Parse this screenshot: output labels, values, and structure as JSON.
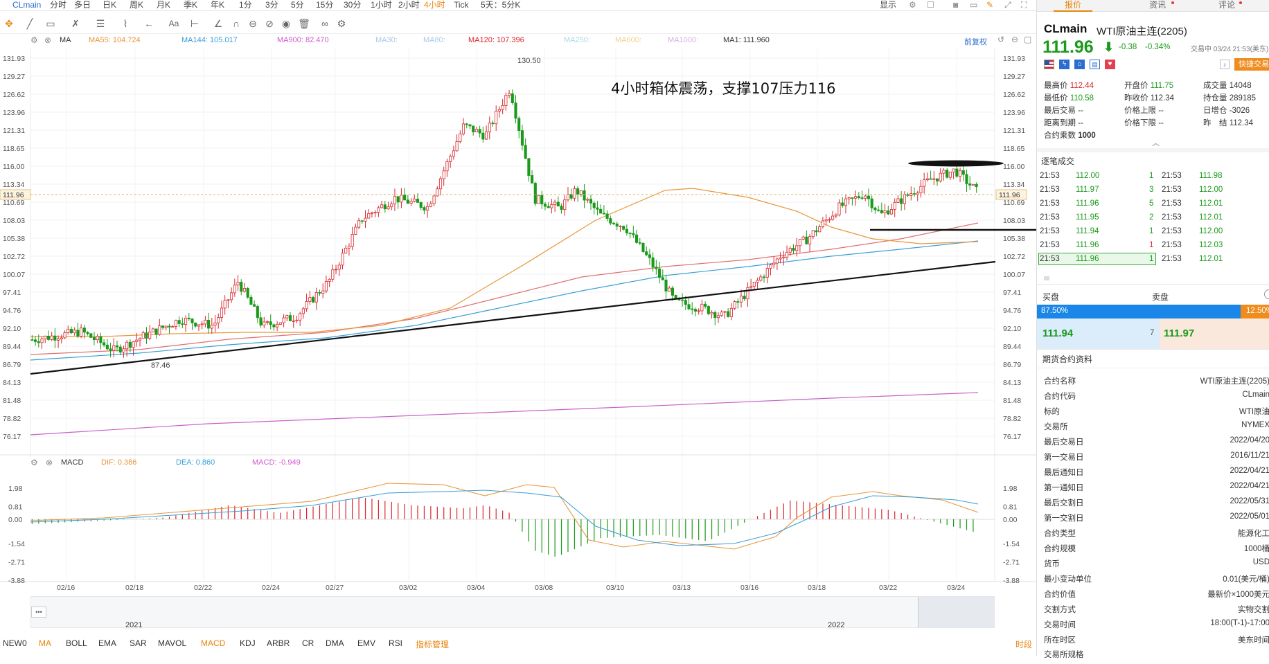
{
  "topbar": {
    "symbol": "CLmain",
    "periods": [
      "分时",
      "多日",
      "日K",
      "周K",
      "月K",
      "季K",
      "年K",
      "1分",
      "3分",
      "5分",
      "15分",
      "30分",
      "1小时",
      "2小时",
      "4小时",
      "Tick",
      "5天：5分K"
    ],
    "active_period": "4小时",
    "display": "显示"
  },
  "toolbar2": {
    "aa": "Aa"
  },
  "ma_bar": {
    "indicator": "MA",
    "items": [
      {
        "label": "MA55: 104.724",
        "color": "#e8963a"
      },
      {
        "label": "MA144: 105.017",
        "color": "#3aa0d8"
      },
      {
        "label": "MA900: 82.470",
        "color": "#d05ad0"
      },
      {
        "label": "MA30:",
        "color": "#a8c8e8"
      },
      {
        "label": "MA80:",
        "color": "#a8c8e8"
      },
      {
        "label": "MA120: 107.396",
        "color": "#d9262c"
      },
      {
        "label": "MA250:",
        "color": "#a8d8e8"
      },
      {
        "label": "MA600:",
        "color": "#f0d090"
      },
      {
        "label": "MA1000:",
        "color": "#d8b0e0"
      },
      {
        "label": "MA1: 111.960",
        "color": "#333333"
      }
    ],
    "fuquan": "前复权"
  },
  "annotation": "4小时箱体震荡，支撑107压力116",
  "price_axis": [
    "131.93",
    "129.27",
    "126.62",
    "123.96",
    "121.31",
    "118.65",
    "116.00",
    "113.34",
    "110.69",
    "108.03",
    "105.38",
    "102.72",
    "100.07",
    "97.41",
    "94.76",
    "92.10",
    "89.44",
    "86.79",
    "84.13",
    "81.48",
    "78.82",
    "76.17"
  ],
  "current_price_tag": "111.96",
  "high_label": "130.50",
  "low_label": "87.46",
  "macd_bar": {
    "indicator": "MACD",
    "dif": "DIF: 0.386",
    "dea": "DEA: 0.860",
    "macd": "MACD: -0.949"
  },
  "macd_axis": [
    "1.98",
    "0.81",
    "0.00",
    "-1.54",
    "-2.71",
    "-3.88"
  ],
  "date_axis": [
    "02/16",
    "02/18",
    "02/22",
    "02/24",
    "02/27",
    "03/02",
    "03/04",
    "03/08",
    "03/10",
    "03/13",
    "03/16",
    "03/18",
    "03/22",
    "03/24"
  ],
  "overview": {
    "year_left": "2021",
    "year_right": "2022",
    "dots": "•••"
  },
  "bottom_tabs": [
    "NEW0",
    "MA",
    "BOLL",
    "EMA",
    "SAR",
    "MAVOL",
    "MACD",
    "KDJ",
    "ARBR",
    "CR",
    "DMA",
    "EMV",
    "RSI",
    "指标管理"
  ],
  "bottom_right": "时段",
  "right": {
    "tabs": [
      "报价",
      "资讯",
      "评论"
    ],
    "symbol": "CLmain",
    "name": "WTI原油主连(2205)",
    "price": "111.96",
    "change": "-0.38",
    "change_pct": "-0.34%",
    "trade_status": "交易中 03/24 21:53(美东)",
    "quick_trade": "快捷交易",
    "stats": [
      {
        "k": "最高价",
        "v": "112.44",
        "c": "red"
      },
      {
        "k": "开盘价",
        "v": "111.75",
        "c": "green"
      },
      {
        "k": "成交量",
        "v": "14048",
        "c": "blk"
      },
      {
        "k": "最低价",
        "v": "110.58",
        "c": "green"
      },
      {
        "k": "昨收价",
        "v": "112.34",
        "c": "blk"
      },
      {
        "k": "持仓量",
        "v": "289185",
        "c": "blk"
      },
      {
        "k": "最后交易",
        "v": "--",
        "c": "blk"
      },
      {
        "k": "价格上限",
        "v": "--",
        "c": "blk"
      },
      {
        "k": "日增仓",
        "v": "-3026",
        "c": "blk"
      },
      {
        "k": "距离到期",
        "v": "--",
        "c": "blk"
      },
      {
        "k": "价格下限",
        "v": "--",
        "c": "blk"
      },
      {
        "k": "昨　结",
        "v": "112.34",
        "c": "blk"
      },
      {
        "k": "合约乘数",
        "v": "1000",
        "c": "blk"
      }
    ],
    "ticks_title": "逐笔成交",
    "ticks": [
      {
        "t1": "21:53",
        "p1": "112.00",
        "q1": "1",
        "q1c": "green",
        "t2": "21:53",
        "p2": "111.98"
      },
      {
        "t1": "21:53",
        "p1": "111.97",
        "q1": "3",
        "q1c": "green",
        "t2": "21:53",
        "p2": "112.00"
      },
      {
        "t1": "21:53",
        "p1": "111.96",
        "q1": "5",
        "q1c": "green",
        "t2": "21:53",
        "p2": "112.01"
      },
      {
        "t1": "21:53",
        "p1": "111.95",
        "q1": "2",
        "q1c": "green",
        "t2": "21:53",
        "p2": "112.01"
      },
      {
        "t1": "21:53",
        "p1": "111.94",
        "q1": "1",
        "q1c": "green",
        "t2": "21:53",
        "p2": "112.00"
      },
      {
        "t1": "21:53",
        "p1": "111.96",
        "q1": "1",
        "q1c": "red",
        "t2": "21:53",
        "p2": "112.03"
      },
      {
        "t1": "21:53",
        "p1": "111.96",
        "q1": "1",
        "q1c": "green",
        "t2": "21:53",
        "p2": "112.01"
      }
    ],
    "buy_label": "买盘",
    "sell_label": "卖盘",
    "buy_pct": "87.50%",
    "sell_pct": "12.50%",
    "buy_price": "111.94",
    "buy_qty": "7",
    "sell_price": "111.97",
    "info_title": "期货合约资料",
    "info": [
      {
        "k": "合约名称",
        "v": "WTI原油主连(2205)"
      },
      {
        "k": "合约代码",
        "v": "CLmain"
      },
      {
        "k": "标的",
        "v": "WTI原油"
      },
      {
        "k": "交易所",
        "v": "NYMEX"
      },
      {
        "k": "最后交易日",
        "v": "2022/04/20"
      },
      {
        "k": "第一交易日",
        "v": "2016/11/21"
      },
      {
        "k": "最后通知日",
        "v": "2022/04/21"
      },
      {
        "k": "第一通知日",
        "v": "2022/04/21"
      },
      {
        "k": "最后交割日",
        "v": "2022/05/31"
      },
      {
        "k": "第一交割日",
        "v": "2022/05/01"
      },
      {
        "k": "合约类型",
        "v": "能源化工"
      },
      {
        "k": "合约规模",
        "v": "1000桶"
      },
      {
        "k": "货币",
        "v": "USD"
      },
      {
        "k": "最小变动单位",
        "v": "0.01(美元/桶)"
      },
      {
        "k": "合约价值",
        "v": "最新价×1000美元"
      },
      {
        "k": "交割方式",
        "v": "实物交割"
      },
      {
        "k": "交易时间",
        "v": "18:00(T-1)-17:00"
      },
      {
        "k": "所在时区",
        "v": "美东时间"
      },
      {
        "k": "交易所规格",
        "v": ""
      }
    ]
  }
}
